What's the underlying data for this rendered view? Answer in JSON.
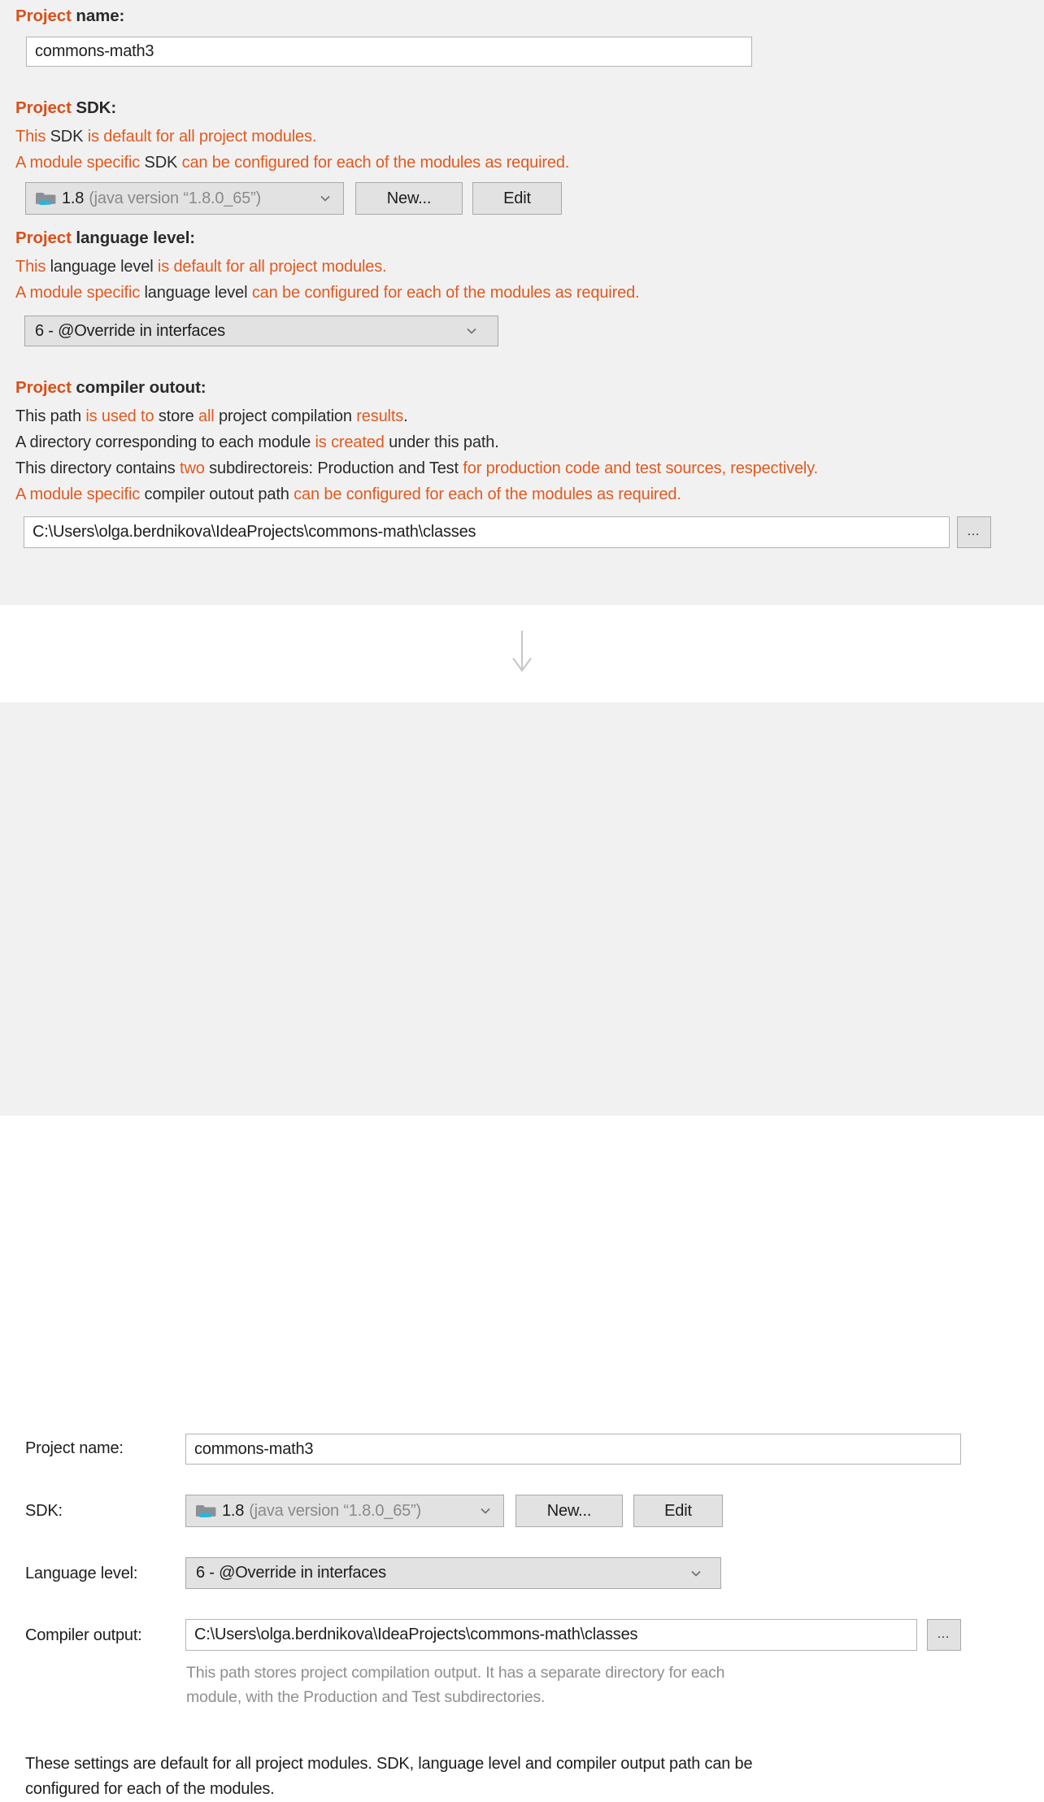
{
  "top_panel": {
    "project_name": {
      "heading_parts": [
        {
          "text": "Project",
          "color": "orange"
        },
        {
          "text": " name:",
          "color": "black"
        }
      ],
      "input_value": "commons-math3"
    },
    "project_sdk": {
      "heading_parts": [
        {
          "text": "Project",
          "color": "orange"
        },
        {
          "text": " SDK:",
          "color": "black"
        }
      ],
      "description_lines": [
        [
          {
            "text": "This ",
            "color": "orange"
          },
          {
            "text": "SDK",
            "color": "black"
          },
          {
            "text": " is default for all project modules.",
            "color": "orange"
          }
        ],
        [
          {
            "text": "A module specific ",
            "color": "orange"
          },
          {
            "text": "SDK",
            "color": "black"
          },
          {
            "text": " can be configured for each of the modules as required.",
            "color": "orange"
          }
        ]
      ],
      "combo_icon": "java-sdk-folder-icon",
      "combo_value_main": "1.8",
      "combo_value_sub": "(java version “1.8.0_65”)",
      "new_button": "New...",
      "edit_button": "Edit"
    },
    "project_language_level": {
      "heading_parts": [
        {
          "text": "Project",
          "color": "orange"
        },
        {
          "text": " language level:",
          "color": "black"
        }
      ],
      "description_lines": [
        [
          {
            "text": "This ",
            "color": "orange"
          },
          {
            "text": "language level",
            "color": "black"
          },
          {
            "text": " is default for all project modules.",
            "color": "orange"
          }
        ],
        [
          {
            "text": "A module specific ",
            "color": "orange"
          },
          {
            "text": "language level",
            "color": "black"
          },
          {
            "text": " can be configured for each of the modules as required.",
            "color": "orange"
          }
        ]
      ],
      "combo_value": "6 - @Override in interfaces"
    },
    "project_compiler_output": {
      "heading_parts": [
        {
          "text": "Project",
          "color": "orange"
        },
        {
          "text": " compiler outout:",
          "color": "black"
        }
      ],
      "description_lines": [
        [
          {
            "text": "This path ",
            "color": "black"
          },
          {
            "text": "is used to ",
            "color": "orange"
          },
          {
            "text": "store ",
            "color": "black"
          },
          {
            "text": "all ",
            "color": "orange"
          },
          {
            "text": "project compilation ",
            "color": "black"
          },
          {
            "text": "results",
            "color": "orange"
          },
          {
            "text": ".",
            "color": "black"
          }
        ],
        [
          {
            "text": "A directory corresponding to each module ",
            "color": "black"
          },
          {
            "text": "is created ",
            "color": "orange"
          },
          {
            "text": "under this path.",
            "color": "black"
          }
        ],
        [
          {
            "text": "This directory contains ",
            "color": "black"
          },
          {
            "text": "two ",
            "color": "orange"
          },
          {
            "text": "subdirectoreis: Production and Test ",
            "color": "black"
          },
          {
            "text": "for production code and test sources, respectively.",
            "color": "orange"
          }
        ],
        [
          {
            "text": "A module specific ",
            "color": "orange"
          },
          {
            "text": "compiler outout path ",
            "color": "black"
          },
          {
            "text": "can be configured for each of the modules as required.",
            "color": "orange"
          }
        ]
      ],
      "input_value": "C:\\Users\\olga.berdnikova\\IdeaProjects\\commons-math\\classes",
      "browse_button": "..."
    }
  },
  "transition": {
    "arrow_icon": "down-arrow-icon"
  },
  "bottom_panel": {
    "rows": [
      {
        "label": "Project name:",
        "value": "commons-math3"
      },
      {
        "label": "SDK:",
        "value_main": "1.8",
        "value_sub": "(java version “1.8.0_65”)"
      },
      {
        "label": "Language level:",
        "value": "6 - @Override in interfaces"
      },
      {
        "label": "Compiler output:",
        "value": "C:\\Users\\olga.berdnikova\\IdeaProjects\\commons-math\\classes"
      }
    ],
    "sdk_new_button": "New...",
    "sdk_edit_button": "Edit",
    "compiler_browse_button": "...",
    "compiler_hint_line1": "This path stores project compilation output. It has a separate directory for each",
    "compiler_hint_line2": "module, with the Production and Test subdirectories.",
    "footnote_line1": "These settings are default for all project modules. SDK, language level and compiler output path can be",
    "footnote_line2": "configured for each of the modules."
  },
  "colors": {
    "accent_orange": "#e05a20",
    "heading_orange": "#d9501a",
    "panel_bg": "#f1f1f1",
    "field_bg": "#ffffff",
    "control_bg": "#e2e2e2",
    "sdk_icon_folder": "#8a9096",
    "sdk_icon_cup": "#29b6d8",
    "muted_text": "#8f8f8f"
  }
}
